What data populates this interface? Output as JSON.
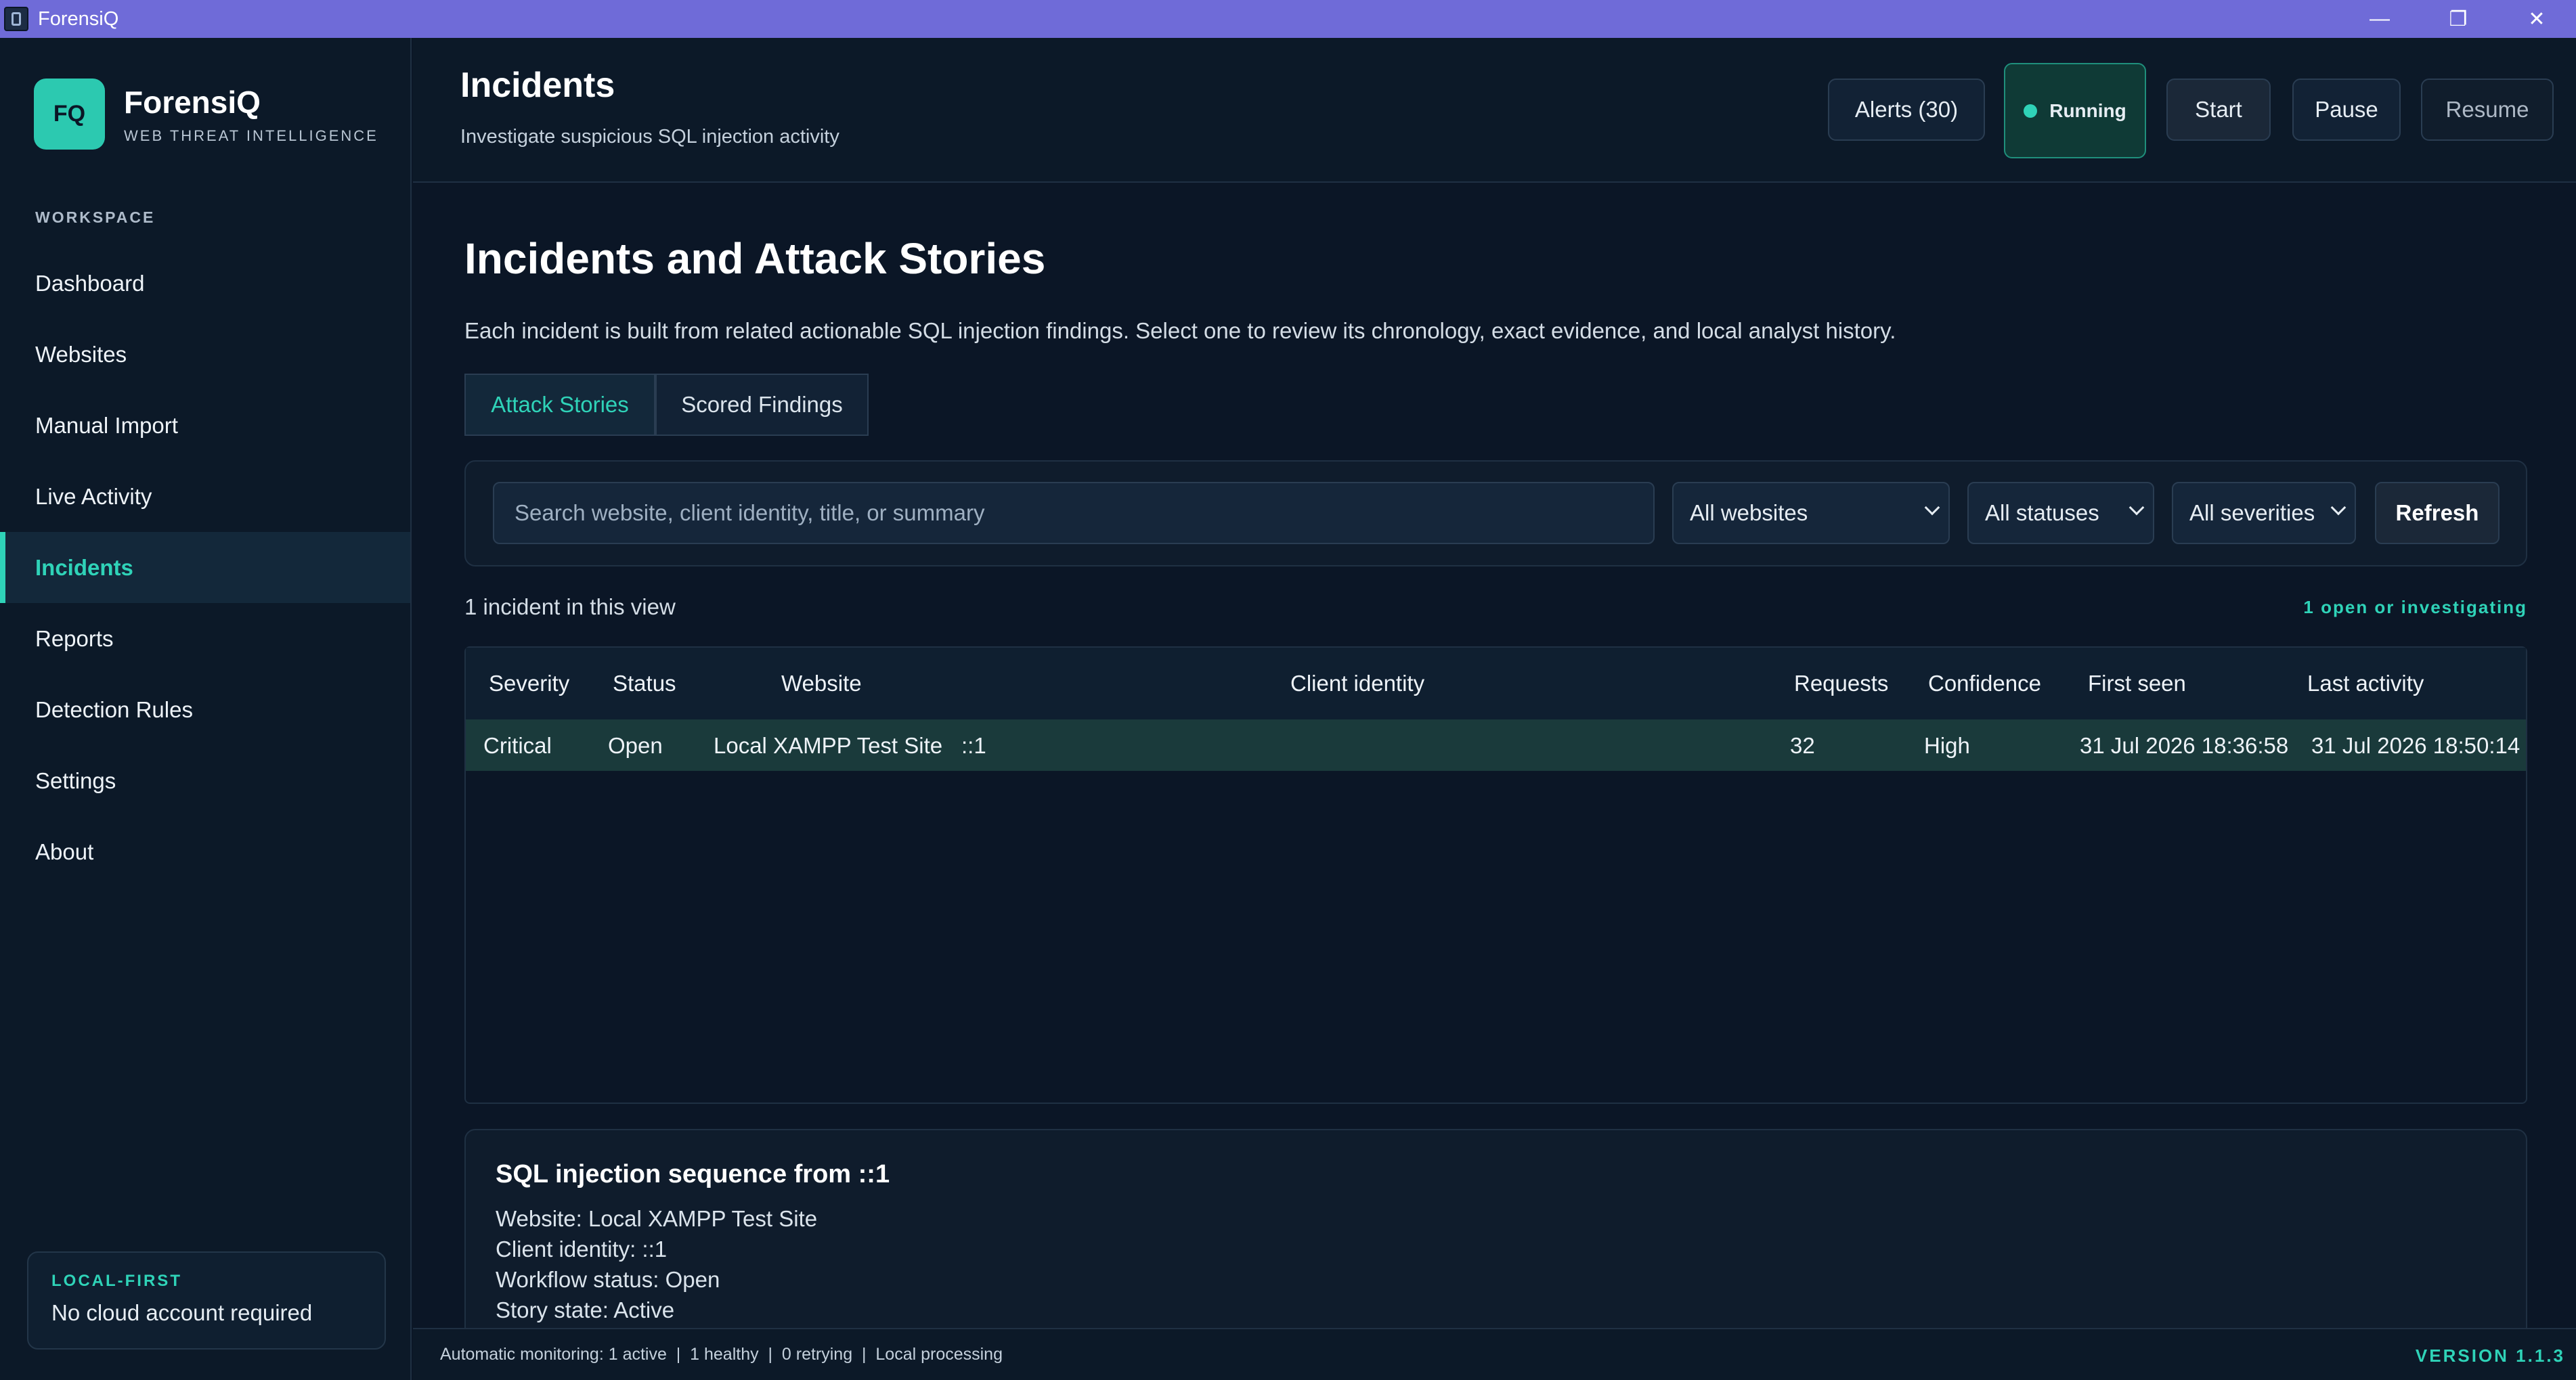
{
  "window": {
    "title": "ForensiQ",
    "minimize": "—",
    "restore": "❐",
    "close": "✕"
  },
  "brand": {
    "logo": "FQ",
    "name": "ForensiQ",
    "tagline": "WEB THREAT INTELLIGENCE"
  },
  "sidebar": {
    "section": "WORKSPACE",
    "items": [
      {
        "label": "Dashboard"
      },
      {
        "label": "Websites"
      },
      {
        "label": "Manual Import"
      },
      {
        "label": "Live Activity"
      },
      {
        "label": "Incidents"
      },
      {
        "label": "Reports"
      },
      {
        "label": "Detection Rules"
      },
      {
        "label": "Settings"
      },
      {
        "label": "About"
      }
    ],
    "active_index": 4,
    "local_card": {
      "title": "LOCAL-FIRST",
      "text": "No cloud account required"
    }
  },
  "header": {
    "title": "Incidents",
    "subtitle": "Investigate suspicious SQL injection activity",
    "alerts_label": "Alerts (30)",
    "running_label": "Running",
    "start_label": "Start",
    "pause_label": "Pause",
    "resume_label": "Resume"
  },
  "main": {
    "title": "Incidents and Attack Stories",
    "description": "Each incident is built from related actionable SQL injection findings. Select one to review its chronology, exact evidence, and local analyst history.",
    "tabs": [
      {
        "label": "Attack Stories"
      },
      {
        "label": "Scored Findings"
      }
    ],
    "filters": {
      "search_placeholder": "Search website, client identity, title, or summary",
      "website": "All websites",
      "status": "All statuses",
      "severity": "All severities",
      "refresh_label": "Refresh"
    },
    "count_text": "1 incident in this view",
    "open_text": "1 open or investigating",
    "table": {
      "headers": [
        "Severity",
        "Status",
        "Website",
        "Client identity",
        "Requests",
        "Confidence",
        "First seen",
        "Last activity"
      ],
      "rows": [
        [
          "Critical",
          "Open",
          "Local XAMPP Test Site",
          "::1",
          "32",
          "High",
          "31 Jul 2026 18:36:58",
          "31 Jul 2026 18:50:14"
        ]
      ]
    },
    "detail": {
      "title": "SQL injection sequence from ::1",
      "lines": [
        "Website: Local XAMPP Test Site",
        "Client identity: ::1",
        "Workflow status: Open",
        "Story state: Active"
      ]
    }
  },
  "statusbar": {
    "text": "Automatic monitoring: 1 active  |  1 healthy  |  0 retrying  |  Local processing",
    "version": "VERSION 1.1.3"
  }
}
